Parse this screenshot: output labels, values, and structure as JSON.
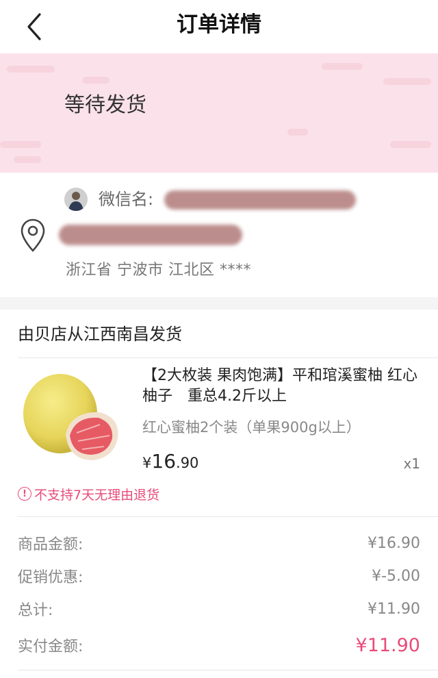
{
  "header": {
    "title": "订单详情"
  },
  "status": {
    "text": "等待发货"
  },
  "address": {
    "wechat_label": "微信名:",
    "region": "浙江省 宁波市 江北区 ****"
  },
  "shop": {
    "ship_from": "由贝店从江西南昌发货"
  },
  "product": {
    "title": "【2大枚装 果肉饱满】平和琯溪蜜柚 红心柚子　重总4.2斤以上",
    "spec": "红心蜜柚2个装（单果900g以上）",
    "price_symbol": "¥",
    "price_int": "16",
    "price_dec": ".90",
    "quantity": "x1",
    "no_return_notice": "不支持7天无理由退货"
  },
  "summary": {
    "goods_amount_label": "商品金额:",
    "goods_amount": "¥16.90",
    "promo_label": "促销优惠:",
    "promo": "¥-5.00",
    "total_label": "总计:",
    "total": "¥11.90",
    "paid_label": "实付金额:",
    "paid": "¥11.90"
  },
  "colors": {
    "accent": "#e84b79",
    "banner": "#fbe1e9"
  },
  "icons": {
    "back": "chevron-left-icon",
    "location": "location-pin-icon",
    "warning": "exclamation-circle-icon"
  }
}
